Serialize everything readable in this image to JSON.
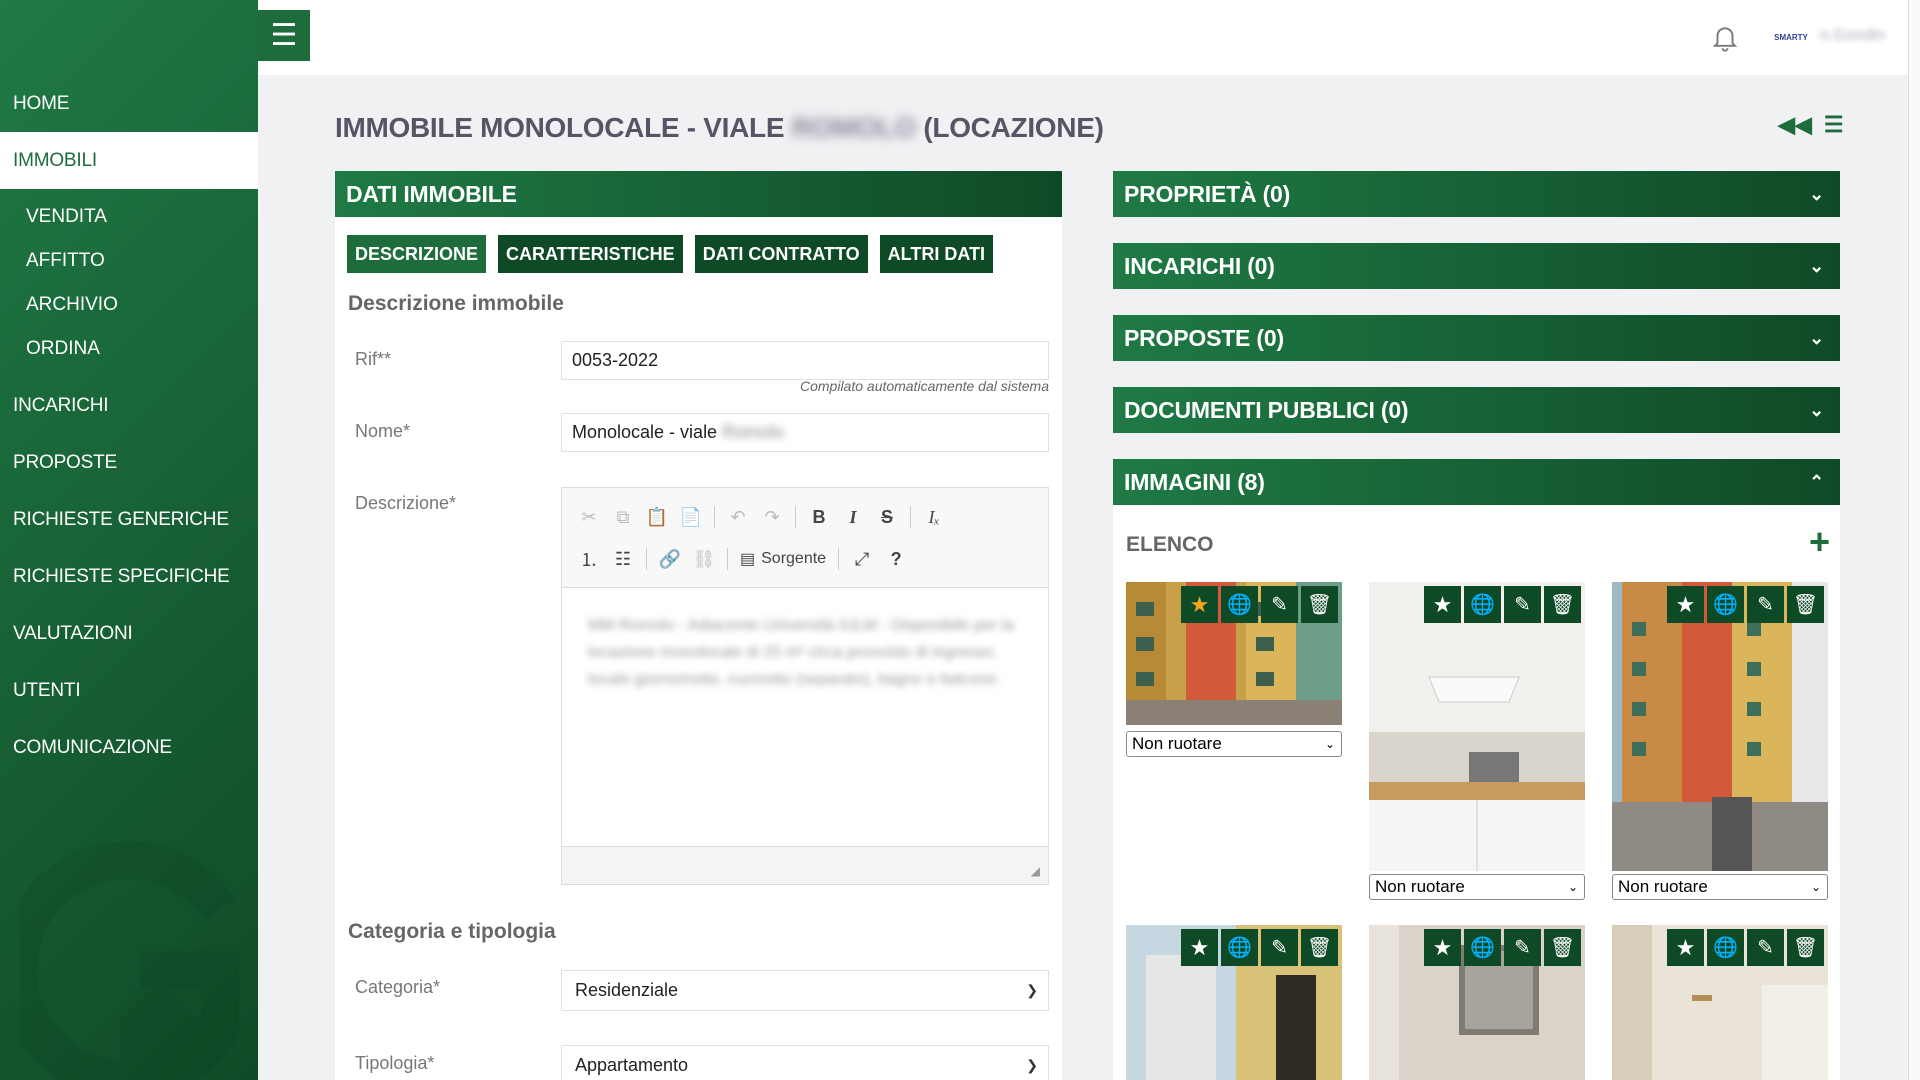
{
  "sidebar": {
    "items": [
      {
        "label": "HOME"
      },
      {
        "label": "IMMOBILI"
      },
      {
        "label": "INCARICHI"
      },
      {
        "label": "PROPOSTE"
      },
      {
        "label": "RICHIESTE GENERICHE"
      },
      {
        "label": "RICHIESTE SPECIFICHE"
      },
      {
        "label": "VALUTAZIONI"
      },
      {
        "label": "UTENTI"
      },
      {
        "label": "COMUNICAZIONE"
      }
    ],
    "sub_items": [
      {
        "label": "VENDITA"
      },
      {
        "label": "AFFITTO"
      },
      {
        "label": "ARCHIVIO"
      },
      {
        "label": "ORDINA"
      }
    ],
    "active": "IMMOBILI"
  },
  "topbar": {
    "menu_icon": "☰",
    "avatar_text": "SMARTY",
    "username": "n.Gondin"
  },
  "page": {
    "title_prefix": "IMMOBILE MONOLOCALE - VIALE",
    "title_blurred": "ROMOLO",
    "title_suffix": "(LOCAZIONE)"
  },
  "left_panel": {
    "header": "DATI IMMOBILE",
    "tabs": [
      "DESCRIZIONE",
      "CARATTERISTICHE",
      "DATI CONTRATTO",
      "ALTRI DATI"
    ],
    "section_description": "Descrizione immobile",
    "rif_label": "Rif**",
    "rif_value": "0053-2022",
    "rif_hint": "Compilato automaticamente dal sistema",
    "nome_label": "Nome*",
    "nome_value": "Monolocale - viale",
    "nome_blurred": "Romolo",
    "descrizione_label": "Descrizione*",
    "editor": {
      "source_label": "Sorgente",
      "help_label": "?",
      "body_text": "MM Romolo - Adiacente Università IULM - Disponibile per la locazione monolocale di 25 m² circa provvisto di ingresso, locale giorno/notte, cucinotto (separato), bagno e balcone."
    },
    "section_category": "Categoria e tipologia",
    "categoria_label": "Categoria*",
    "categoria_value": "Residenziale",
    "tipologia_label": "Tipologia*",
    "tipologia_value": "Appartamento"
  },
  "right_panel": {
    "accordions": [
      {
        "label": "PROPRIETÀ (0)"
      },
      {
        "label": "INCARICHI (0)"
      },
      {
        "label": "PROPOSTE (0)"
      },
      {
        "label": "DOCUMENTI PUBBLICI (0)"
      },
      {
        "label": "IMMAGINI (8)"
      }
    ],
    "images_list_title": "ELENCO",
    "add_label": "+",
    "rotation_option": "Non ruotare"
  },
  "colors": {
    "brand_green": "#1e6b3c",
    "dark_green": "#0f4a27",
    "accent_orange": "#f1a51c"
  }
}
